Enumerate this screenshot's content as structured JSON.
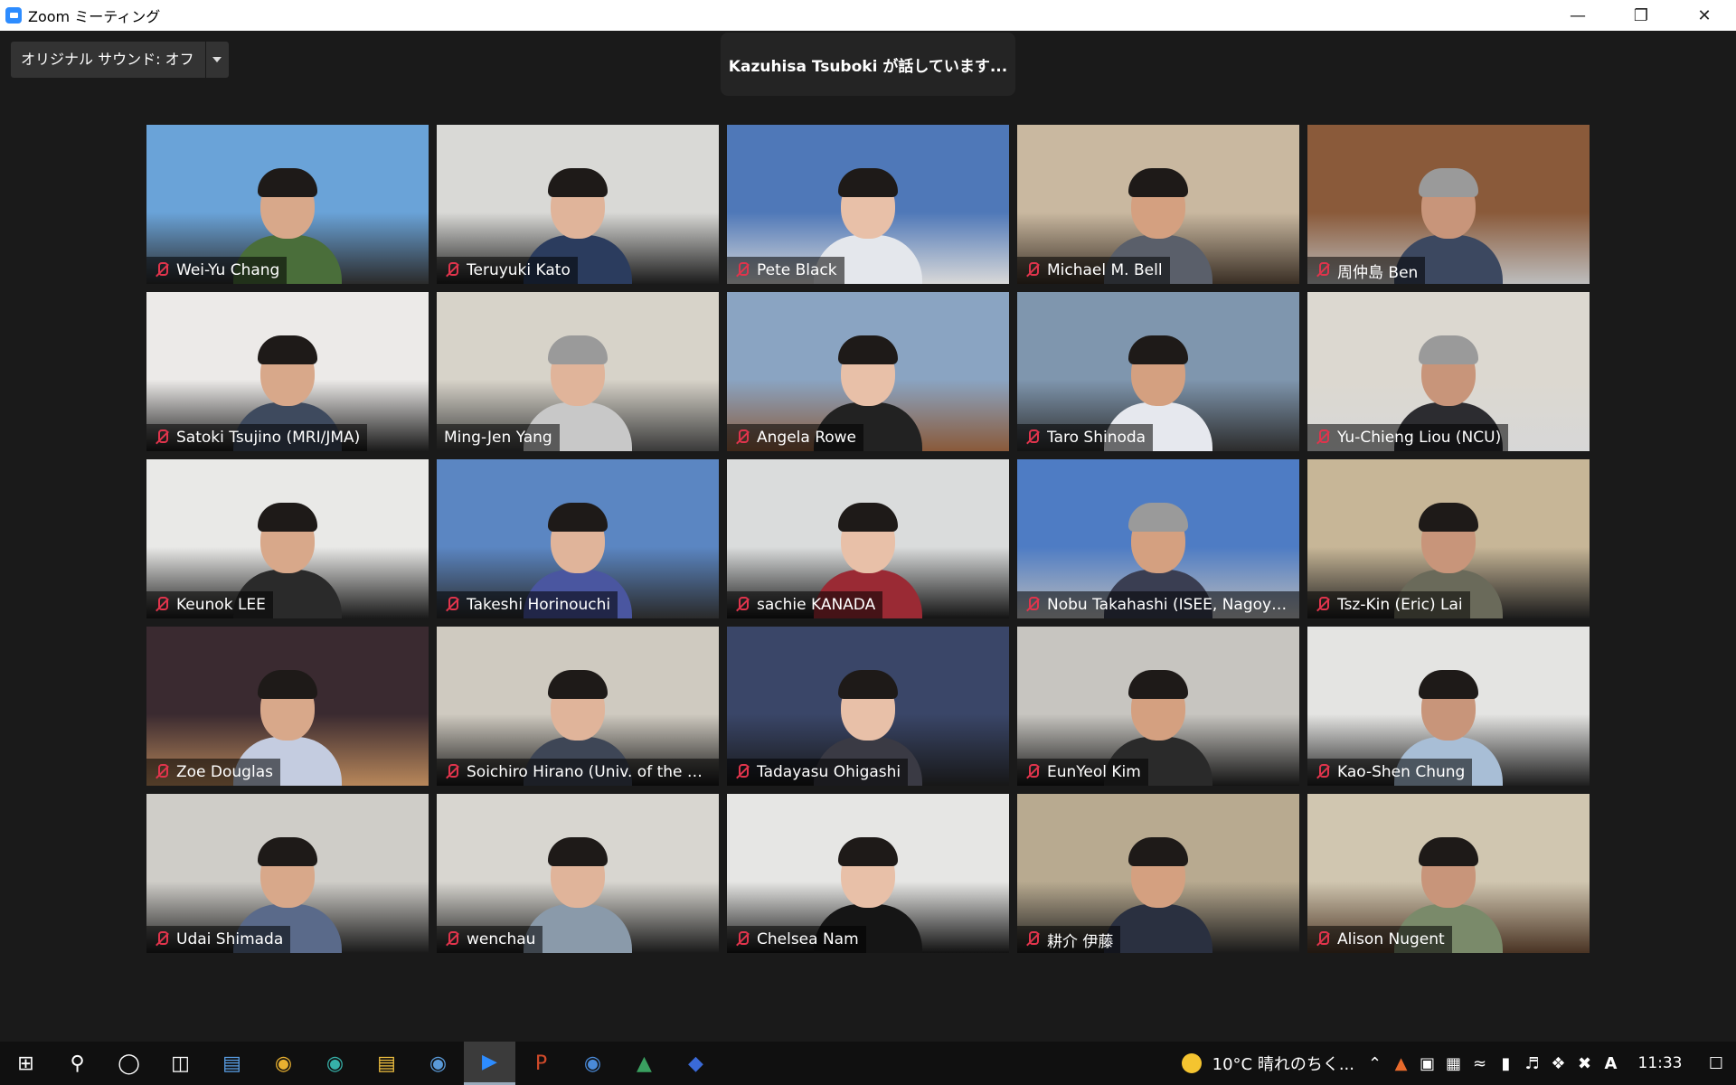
{
  "window": {
    "title": "Zoom ミーティング"
  },
  "toolbar": {
    "original_sound_label": "オリジナル サウンド: オフ"
  },
  "speaking_banner": "Kazuhisa Tsuboki が話しています...",
  "participants": [
    {
      "name": "Wei-Yu Chang",
      "muted": true
    },
    {
      "name": "Teruyuki Kato",
      "muted": true
    },
    {
      "name": "Pete Black",
      "muted": true
    },
    {
      "name": "Michael M. Bell",
      "muted": true
    },
    {
      "name": "周仲島 Ben",
      "muted": true
    },
    {
      "name": "Satoki Tsujino (MRI/JMA)",
      "muted": true
    },
    {
      "name": "Ming-Jen Yang",
      "muted": false
    },
    {
      "name": "Angela Rowe",
      "muted": true
    },
    {
      "name": "Taro Shinoda",
      "muted": true
    },
    {
      "name": "Yu-Chieng Liou (NCU)",
      "muted": true
    },
    {
      "name": "Keunok LEE",
      "muted": true
    },
    {
      "name": "Takeshi Horinouchi",
      "muted": true
    },
    {
      "name": "sachie KANADA",
      "muted": true
    },
    {
      "name": "Nobu Takahashi (ISEE, Nagoya ...",
      "muted": true
    },
    {
      "name": "Tsz-Kin (Eric) Lai",
      "muted": true
    },
    {
      "name": "Zoe Douglas",
      "muted": true
    },
    {
      "name": "Soichiro Hirano (Univ. of the Ry...",
      "muted": true
    },
    {
      "name": "Tadayasu Ohigashi",
      "muted": true
    },
    {
      "name": "EunYeol Kim",
      "muted": true
    },
    {
      "name": "Kao-Shen Chung",
      "muted": true
    },
    {
      "name": "Udai Shimada",
      "muted": true
    },
    {
      "name": "wenchau",
      "muted": true
    },
    {
      "name": "Chelsea Nam",
      "muted": true
    },
    {
      "name": "耕介 伊藤",
      "muted": true
    },
    {
      "name": "Alison Nugent",
      "muted": true
    }
  ],
  "taskbar": {
    "apps": [
      "start-icon",
      "search-icon",
      "cortana-icon",
      "task-view-icon",
      "network-app-icon",
      "chrome-icon",
      "edge-icon",
      "file-explorer-icon",
      "globe-app-icon",
      "zoom-icon",
      "powerpoint-icon",
      "chat-app-icon",
      "image-app-icon",
      "terminal-app-icon"
    ],
    "active_app": "zoom-icon",
    "weather": "10°C  晴れのちく...",
    "clock": "11:33"
  }
}
